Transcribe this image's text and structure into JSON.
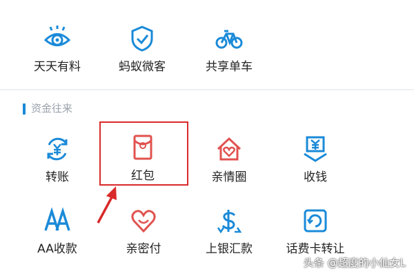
{
  "colors": {
    "brand_blue": "#1a8ad8",
    "accent_red": "#e0524f",
    "highlight": "#d9292a"
  },
  "top_row": [
    {
      "label": "天天有料",
      "icon": "eye-icon"
    },
    {
      "label": "蚂蚁微客",
      "icon": "shield-check-icon"
    },
    {
      "label": "共享单车",
      "icon": "bicycle-icon"
    }
  ],
  "section": {
    "title": "资金往来"
  },
  "funds_row1": [
    {
      "label": "转账",
      "icon": "yuan-transfer-icon"
    },
    {
      "label": "红包",
      "icon": "red-envelope-icon"
    },
    {
      "label": "亲情圈",
      "icon": "house-heart-icon"
    },
    {
      "label": "收钱",
      "icon": "yuan-collect-icon"
    }
  ],
  "funds_row2": [
    {
      "label": "AA收款",
      "icon": "aa-icon"
    },
    {
      "label": "亲密付",
      "icon": "heart-icon"
    },
    {
      "label": "上银汇款",
      "icon": "dollar-icon"
    },
    {
      "label": "话费卡转让",
      "icon": "phone-card-icon"
    }
  ],
  "watermark": "头条 @超度的小仙女L"
}
